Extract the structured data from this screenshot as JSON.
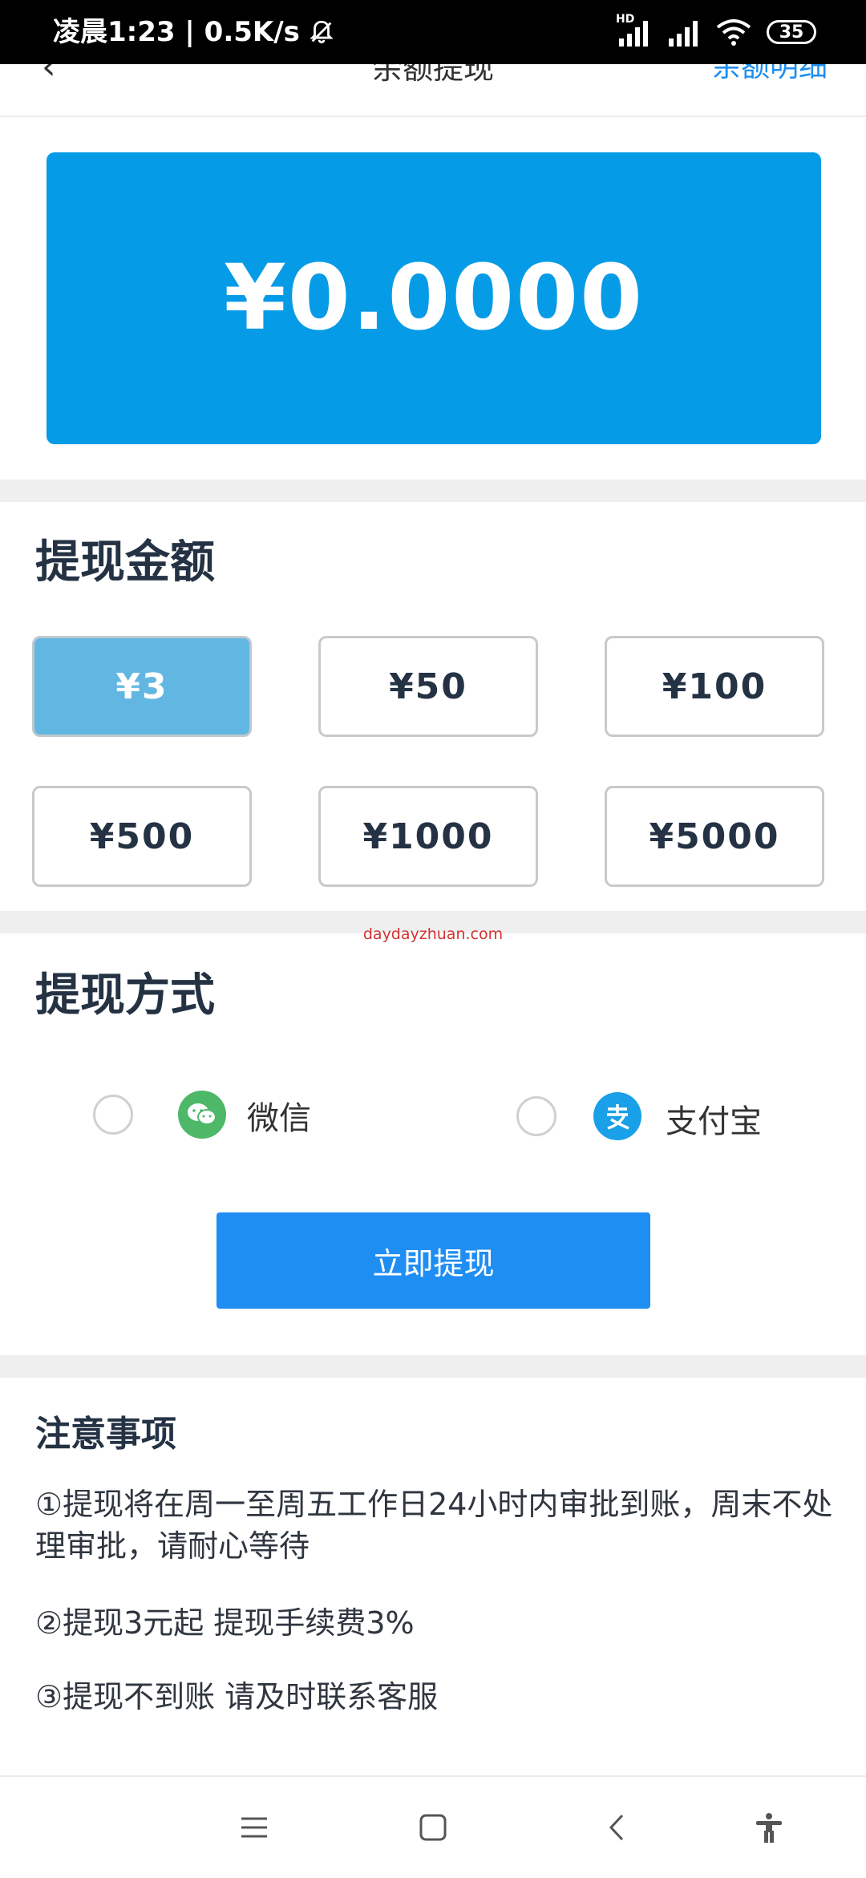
{
  "status_bar": {
    "time_network": "凌晨1:23 | 0.5K/s",
    "signal_label": "HD",
    "battery": "35"
  },
  "header": {
    "back_icon": "chevron-left-icon",
    "title": "余额提现",
    "right_link": "余额明细"
  },
  "balance": {
    "amount": "¥0.0000",
    "card_color": "#069be6"
  },
  "withdraw_amount": {
    "title": "提现金额",
    "selected_index": 0,
    "options": [
      "¥3",
      "¥50",
      "¥100",
      "¥500",
      "¥1000",
      "¥5000"
    ]
  },
  "watermark": "daydayzhuan.com",
  "withdraw_method": {
    "title": "提现方式",
    "options": [
      {
        "label": "微信",
        "icon": "wechat-icon",
        "color": "#4cb868"
      },
      {
        "label": "支付宝",
        "icon": "alipay-icon",
        "color": "#1aa0e8"
      }
    ]
  },
  "submit_label": "立即提现",
  "notes": {
    "title": "注意事项",
    "items": [
      "①提现将在周一至周五工作日24小时内审批到账，周末不处理审批，请耐心等待",
      "②提现3元起 提现手续费3%",
      "③提现不到账 请及时联系客服"
    ]
  },
  "nav_bar": {
    "icons": [
      "menu-icon",
      "home-square-icon",
      "back-icon",
      "accessibility-icon"
    ]
  },
  "colors": {
    "accent": "#1f8ef3",
    "selected_amount": "#62b7e2"
  }
}
